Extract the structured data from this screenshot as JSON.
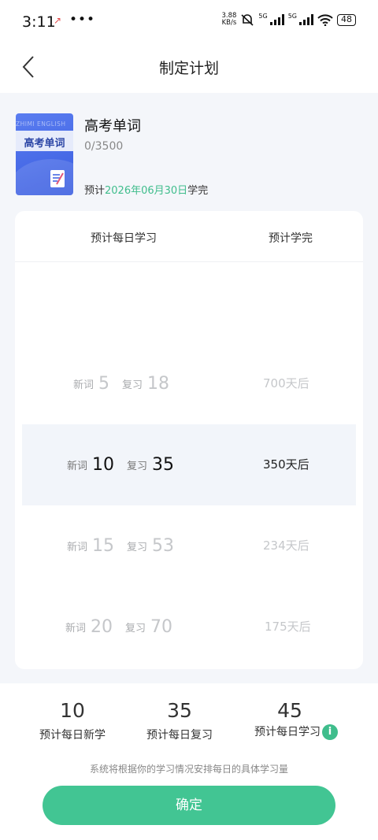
{
  "status_bar": {
    "time": "3:11",
    "notif_glyph": "↗",
    "dots": "•••",
    "speed_top": "3.88",
    "speed_bottom": "KB/s",
    "sig1_label": "5G",
    "sig2_label": "5G",
    "battery": "48"
  },
  "header": {
    "title": "制定计划"
  },
  "book": {
    "cover_top_text": "ZHIMI ENGLISH",
    "cover_title": "高考单词",
    "title": "高考单词",
    "progress": "0/3500",
    "finish_prefix": "预计",
    "finish_date": "2026年06月30日",
    "finish_suffix": "学完"
  },
  "plan": {
    "col_daily": "预计每日学习",
    "col_finish": "预计学完",
    "rows": [
      {
        "new_label": "新词",
        "new": "5",
        "review_label": "复习",
        "review": "18",
        "days": "700天后"
      },
      {
        "new_label": "新词",
        "new": "10",
        "review_label": "复习",
        "review": "35",
        "days": "350天后"
      },
      {
        "new_label": "新词",
        "new": "15",
        "review_label": "复习",
        "review": "53",
        "days": "234天后"
      },
      {
        "new_label": "新词",
        "new": "20",
        "review_label": "复习",
        "review": "70",
        "days": "175天后"
      }
    ]
  },
  "summary": {
    "new_value": "10",
    "new_label": "预计每日新学",
    "review_value": "35",
    "review_label": "预计每日复习",
    "total_value": "45",
    "total_label": "预计每日学习",
    "info_glyph": "i",
    "note": "系统将根据你的学习情况安排每日的具体学习量",
    "confirm": "确定"
  },
  "colors": {
    "accent": "#42c593",
    "date_green": "#3fbd8c",
    "selected_bg": "#f2f5fa"
  }
}
